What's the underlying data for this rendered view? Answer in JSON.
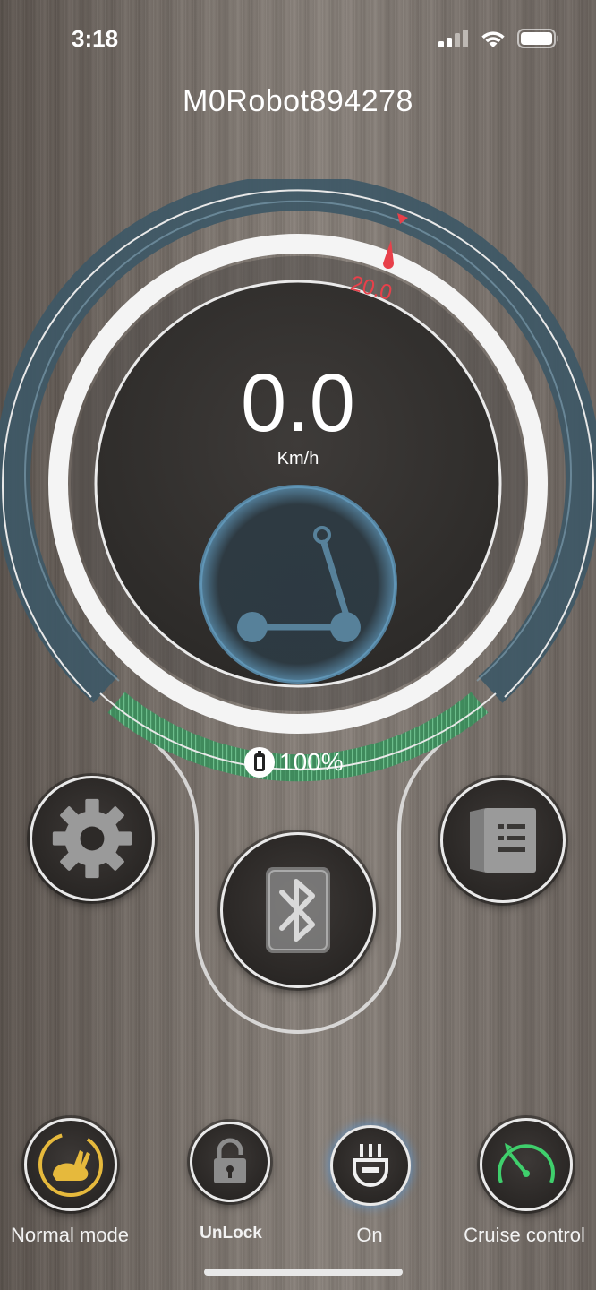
{
  "status_bar": {
    "time": "3:18"
  },
  "header": {
    "device_name": "M0Robot894278"
  },
  "speedometer": {
    "speed": "0.0",
    "unit": "Km/h",
    "speed_limit_marker": "20.0",
    "battery_percent": "100%",
    "battery_level": 1.0,
    "colors": {
      "outer_arc": "#3e5866",
      "battery_arc": "#3f8a5c",
      "marker": "#e8404a"
    }
  },
  "controls": {
    "settings_icon": "gear-icon",
    "bluetooth_icon": "bluetooth-icon",
    "manual_icon": "book-icon"
  },
  "bottom_bar": {
    "mode_label": "Normal mode",
    "lock_label": "UnLock",
    "light_label": "On",
    "cruise_label": "Cruise control"
  }
}
